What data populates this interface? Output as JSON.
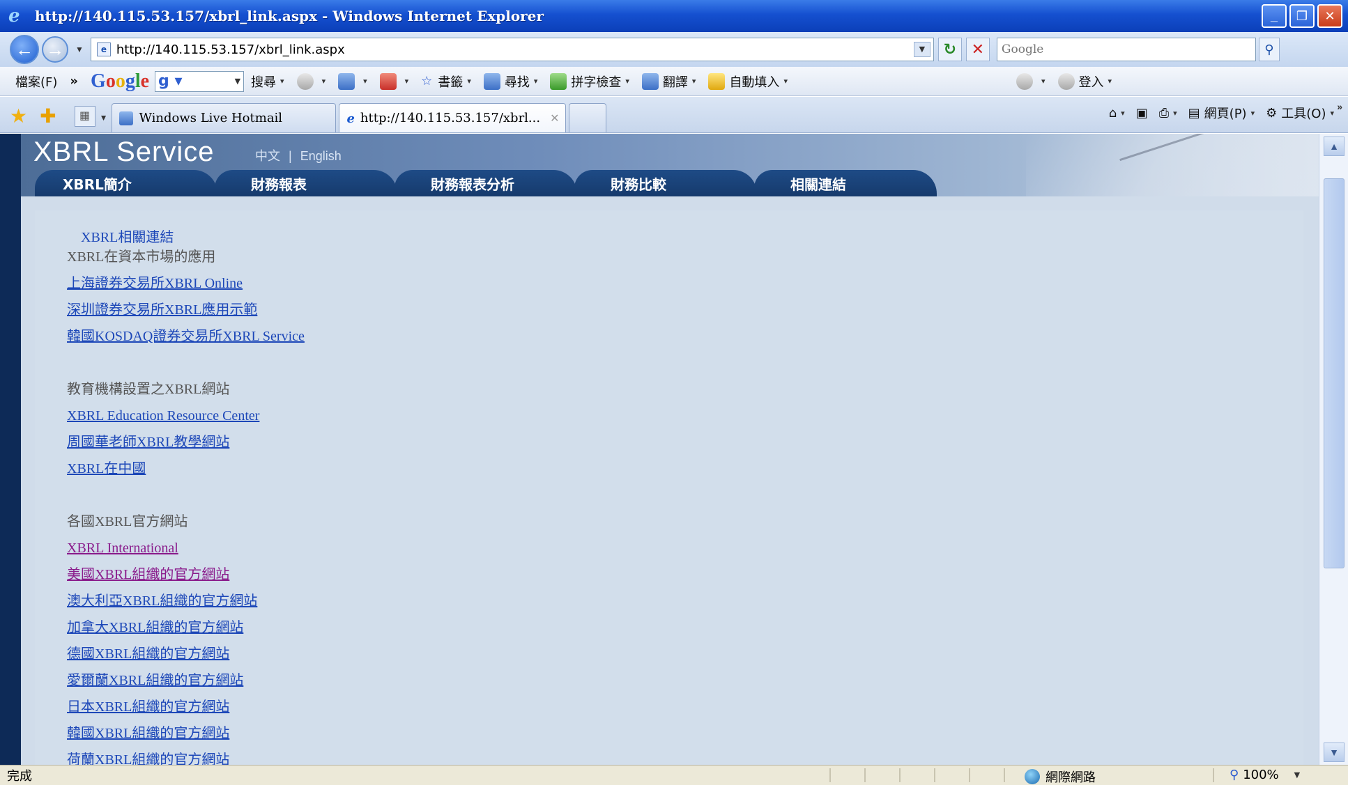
{
  "window": {
    "title": "http://140.115.53.157/xbrl_link.aspx - Windows Internet Explorer",
    "minimize": "_",
    "restore": "❐",
    "close": "✕"
  },
  "address": {
    "url": "http://140.115.53.157/xbrl_link.aspx",
    "search_placeholder": "Google"
  },
  "toolbar": {
    "file_menu": "檔案(F)",
    "overflow": "»",
    "google_brand": "Google",
    "search_label": "搜尋",
    "bookmarks_label": "書籤",
    "find_label": "尋找",
    "spellcheck_label": "拼字檢查",
    "translate_label": "翻譯",
    "autofill_label": "自動填入",
    "signin_label": "登入"
  },
  "tabs": {
    "items": [
      {
        "label": "Windows Live Hotmail",
        "active": false
      },
      {
        "label": "http://140.115.53.157/xbrl...",
        "active": true
      }
    ],
    "page_menu": "網頁(P)",
    "tools_menu": "工具(O)"
  },
  "site": {
    "brand": "XBRL Service",
    "lang_zh": "中文",
    "lang_sep": "|",
    "lang_en": "English",
    "nav": [
      "XBRL簡介",
      "財務報表",
      "財務報表分析",
      "財務比較",
      "相關連結"
    ]
  },
  "content": {
    "heading": "XBRL相關連結",
    "groups": [
      {
        "title": "XBRL在資本市場的應用",
        "links": [
          {
            "text": "上海證券交易所XBRL Online",
            "visited": false
          },
          {
            "text": "深圳證券交易所XBRL應用示範",
            "visited": false
          },
          {
            "text": "韓國KOSDAQ證券交易所XBRL Service",
            "visited": false
          }
        ]
      },
      {
        "title": "教育機構設置之XBRL網站",
        "links": [
          {
            "text": "XBRL Education Resource Center",
            "visited": false
          },
          {
            "text": "周國華老師XBRL教學網站",
            "visited": false
          },
          {
            "text": "XBRL在中國",
            "visited": false
          }
        ]
      },
      {
        "title": "各國XBRL官方網站",
        "links": [
          {
            "text": "XBRL International",
            "visited": true
          },
          {
            "text": "美國XBRL組織的官方網站",
            "visited": true
          },
          {
            "text": "澳大利亞XBRL組織的官方網站",
            "visited": false
          },
          {
            "text": "加拿大XBRL組織的官方網站",
            "visited": false
          },
          {
            "text": "德國XBRL組織的官方網站",
            "visited": false
          },
          {
            "text": "愛爾蘭XBRL組織的官方網站",
            "visited": false
          },
          {
            "text": "日本XBRL組織的官方網站",
            "visited": false
          },
          {
            "text": "韓國XBRL組織的官方網站",
            "visited": false
          },
          {
            "text": "荷蘭XBRL組織的官方網站",
            "visited": false
          }
        ]
      }
    ]
  },
  "status": {
    "text": "完成",
    "zone": "網際網路",
    "zoom": "100%"
  }
}
